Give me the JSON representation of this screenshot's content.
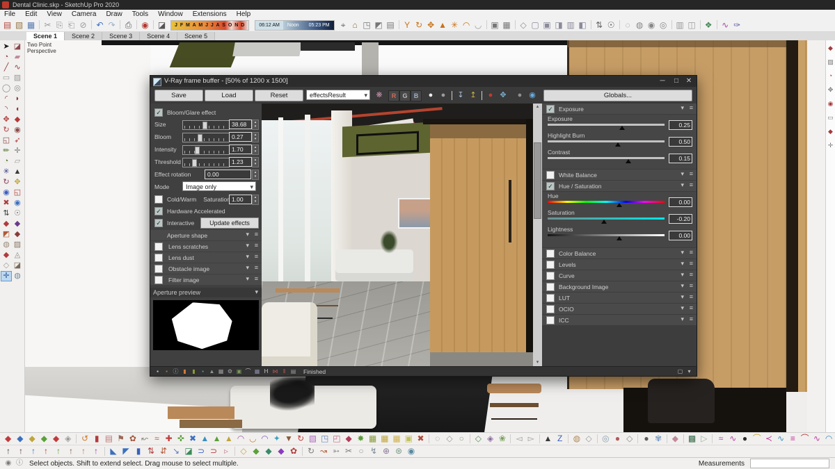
{
  "colors": {
    "accent_red": "#c0392b",
    "vray_panel": "#404040",
    "wood": "#c79d66",
    "select_blue": "#bcd8f0"
  },
  "window": {
    "title": "Dental Clinic.skp - SketchUp Pro 2020"
  },
  "menu": {
    "items": [
      "File",
      "Edit",
      "View",
      "Camera",
      "Draw",
      "Tools",
      "Window",
      "Extensions",
      "Help"
    ]
  },
  "toolbar": {
    "months": "J F M A M J J A S O N D",
    "time_start": "06:12 AM",
    "time_mid": "Noon",
    "time_end": "05:23 PM",
    "icons_a": [
      [
        "new-model",
        "▤",
        "#b34a3a"
      ],
      [
        "open-model",
        "▧",
        "#9a7a4a"
      ],
      [
        "save-model",
        "▦",
        "#5a7ab0"
      ],
      [
        "|"
      ],
      [
        "cut",
        "✂",
        "#9a9a9a"
      ],
      [
        "copy",
        "⎘",
        "#9a9a9a"
      ],
      [
        "paste",
        "⎗",
        "#9a9a9a"
      ],
      [
        "erase",
        "⊘",
        "#9a9a9a"
      ],
      [
        "|"
      ],
      [
        "undo",
        "↶",
        "#3a6fc4"
      ],
      [
        "redo",
        "↷",
        "#9ab0c8"
      ],
      [
        "|"
      ],
      [
        "print",
        "⎙",
        "#555555"
      ],
      [
        "|"
      ],
      [
        "vray-asset-editor",
        "◉",
        "#b3382e"
      ],
      [
        "|"
      ],
      [
        "shadow-eraser",
        "◪",
        "#555555"
      ]
    ],
    "icons_b": [
      [
        "in-model",
        "⌖",
        "#666666"
      ],
      [
        "components",
        "⌂",
        "#8a6d3b"
      ],
      [
        "materials",
        "◳",
        "#777777"
      ],
      [
        "styles",
        "◩",
        "#777777"
      ],
      [
        "export",
        "▤",
        "#777777"
      ],
      [
        "|"
      ],
      [
        "field-of-view",
        "Y",
        "#c8731a"
      ],
      [
        "orbit",
        "↻",
        "#c8731a"
      ],
      [
        "pan",
        "✥",
        "#c8731a"
      ],
      [
        "zoom",
        "▲",
        "#c8731a"
      ],
      [
        "zoom-extents",
        "✳",
        "#c8731a"
      ],
      [
        "previous-view",
        "◠",
        "#c8731a"
      ],
      [
        "next-view",
        "◡",
        "#999999"
      ],
      [
        "|"
      ],
      [
        "make-group",
        "▣",
        "#777777"
      ],
      [
        "make-component",
        "▦",
        "#777777"
      ],
      [
        "|"
      ],
      [
        "view-iso",
        "◇",
        "#8a8a9a"
      ],
      [
        "view-top",
        "▢",
        "#8a8a9a"
      ],
      [
        "view-front",
        "▣",
        "#8a8a9a"
      ],
      [
        "view-right",
        "◨",
        "#8a8a9a"
      ],
      [
        "view-back",
        "▥",
        "#8a8a9a"
      ],
      [
        "view-left",
        "◧",
        "#8a8a9a"
      ],
      [
        "|"
      ],
      [
        "walk-through",
        "⇅",
        "#666666"
      ],
      [
        "look-around",
        "☉",
        "#666666"
      ],
      [
        "|"
      ],
      [
        "style-wireframe",
        "◌",
        "#888888"
      ],
      [
        "style-shaded",
        "◍",
        "#888888"
      ],
      [
        "style-textured",
        "◉",
        "#888888"
      ],
      [
        "style-monochrome",
        "◎",
        "#888888"
      ],
      [
        "|"
      ],
      [
        "section-plane",
        "▥",
        "#999999"
      ],
      [
        "section-display",
        "◫",
        "#999999"
      ],
      [
        "|"
      ],
      [
        "tags",
        "❖",
        "#4a8a5a"
      ],
      [
        "|"
      ],
      [
        "bezier",
        "∿",
        "#a34a9a"
      ],
      [
        "3d-text",
        "✑",
        "#5a5aa3"
      ]
    ]
  },
  "scene_tabs": [
    "Scene 1",
    "Scene 2",
    "Scene 3",
    "Scene 4",
    "Scene 5"
  ],
  "palette_icons": [
    [
      "select",
      "➤",
      "#1a1a1a"
    ],
    [
      "eraser",
      "◪",
      "#8a4a4a"
    ],
    [
      "paint",
      "◔",
      "#8a4a4a"
    ],
    [
      "bucket",
      "▰",
      "#c08a9a"
    ],
    [
      "line",
      "╱",
      "#8a3b3b"
    ],
    [
      "freehand",
      "∿",
      "#8a3b3b"
    ],
    [
      "rectangle",
      "▭",
      "#9a9a9a"
    ],
    [
      "rotated-rectangle",
      "▨",
      "#9a9a9a"
    ],
    [
      "circle",
      "◯",
      "#8a8a8a"
    ],
    [
      "polygon",
      "◎",
      "#8a8a8a"
    ],
    [
      "arc",
      "◜",
      "#8a3b3b"
    ],
    [
      "pie",
      "◗",
      "#8a3b3b"
    ],
    [
      "arc-2",
      "◝",
      "#8a3b3b"
    ],
    [
      "pie-2",
      "◖",
      "#8a3b3b"
    ],
    [
      "move",
      "✥",
      "#b03b3b"
    ],
    [
      "push-pull",
      "◆",
      "#b03b3b"
    ],
    [
      "rotate",
      "↻",
      "#b03b3b"
    ],
    [
      "follow-me",
      "◉",
      "#8a4a4a"
    ],
    [
      "scale",
      "◱",
      "#8a4a4a"
    ],
    [
      "offset",
      "➶",
      "#b03b3b"
    ],
    [
      "tape-measure",
      "✏",
      "#5a7a3a"
    ],
    [
      "dimensions",
      "✛",
      "#7a7a7a"
    ],
    [
      "protractor",
      "◔",
      "#5a7a3a"
    ],
    [
      "text",
      "▱",
      "#9a9a9a"
    ],
    [
      "axes",
      "✳",
      "#3a3a8a"
    ],
    [
      "3d-text",
      "▲",
      "#3a3a3a"
    ],
    [
      "orbit",
      "↻",
      "#8a3b5a"
    ],
    [
      "pan",
      "✥",
      "#c0a53b"
    ],
    [
      "zoom",
      "◉",
      "#3b5fc0"
    ],
    [
      "zoom-window",
      "◱",
      "#b03b3b"
    ],
    [
      "zoom-extents",
      "✖",
      "#b03b3b"
    ],
    [
      "previous",
      "◉",
      "#3b6fc0"
    ],
    [
      "walk",
      "⇅",
      "#3a3a3a"
    ],
    [
      "look-around",
      "☉",
      "#7a7a7a"
    ],
    [
      "section",
      "◆",
      "#b03b3b"
    ],
    [
      "soften",
      "◆",
      "#6a3a8a"
    ],
    [
      "sandbox-from-contours",
      "◩",
      "#b05a3a"
    ],
    [
      "sandbox-from-scratch",
      "◆",
      "#8a3b3b"
    ],
    [
      "smoove",
      "◍",
      "#9a8a7a"
    ],
    [
      "stamp",
      "▨",
      "#8a7a6a"
    ],
    [
      "drape",
      "◆",
      "#b03b3b"
    ],
    [
      "add-detail",
      "◬",
      "#8a8a8a"
    ],
    [
      "flip-edge",
      "◇",
      "#9a9a9a"
    ],
    [
      "tool-extra",
      "◪",
      "#7a6a5a"
    ],
    [
      "active-tool",
      "✛",
      "#2a5a9a",
      "hl"
    ],
    [
      "tool-extra-2",
      "◍",
      "#7a8a9a"
    ]
  ],
  "rightstrip_icons": [
    [
      "solid-union",
      "◆",
      "#a33b3b"
    ],
    [
      "solid-subtract",
      "▨",
      "#777777"
    ],
    [
      "solid-trim",
      "◔",
      "#a33b3b"
    ],
    [
      "solid-intersect",
      "✥",
      "#777777"
    ],
    [
      "solid-split",
      "◉",
      "#a33b3b"
    ],
    [
      "outer-shell",
      "▭",
      "#777777"
    ],
    [
      "solid-tool",
      "◆",
      "#a33b3b"
    ],
    [
      "solid-tool-2",
      "✛",
      "#777777"
    ]
  ],
  "viewport": {
    "camera_label_line1": "Two Point",
    "camera_label_line2": "Perspective"
  },
  "vfb": {
    "title": "V-Ray frame buffer - [50% of 1200 x 1500]",
    "controls": {
      "minimize": "─",
      "maximize": "□",
      "close": "✕"
    },
    "buttons": {
      "save": "Save",
      "load": "Load",
      "reset": "Reset"
    },
    "channel_dropdown": "effectsResult",
    "rgb": [
      "R",
      "G",
      "B"
    ],
    "globals_button": "Globals...",
    "toolbar_icons_pre": [
      [
        "color-corrections",
        "❋",
        "#cc8fae"
      ]
    ],
    "toolbar_icons_mid": [
      [
        "show-rgb",
        "●",
        "#ececec"
      ],
      [
        "show-alpha",
        "●",
        "#9c9c9c"
      ],
      [
        "|"
      ],
      [
        "save-image",
        "↧",
        "#a8c0dc"
      ],
      [
        "load-image",
        "↥",
        "#d6b94a"
      ],
      [
        "|"
      ],
      [
        "clear-image",
        "●",
        "#c03b2e"
      ],
      [
        "follow-mouse",
        "✥",
        "#7ab0d0"
      ]
    ],
    "toolbar_icons_right": [
      [
        "render-sphere",
        "●",
        "#8f8f8f"
      ],
      [
        "lens-effects-eye",
        "◉",
        "#66aadd"
      ]
    ],
    "left": {
      "bloom_glare": {
        "label": "Bloom/Glare effect",
        "checked": true
      },
      "sliders": [
        {
          "label": "Size",
          "value": "38.68",
          "pos": 43
        },
        {
          "label": "Bloom",
          "value": "0.27",
          "pos": 32
        },
        {
          "label": "Intensity",
          "value": "1.70",
          "pos": 26
        },
        {
          "label": "Threshold",
          "value": "1.23",
          "pos": 20
        }
      ],
      "effect_rotation": {
        "label": "Effect rotation",
        "value": "0.00"
      },
      "mode": {
        "label": "Mode",
        "value": "Image only"
      },
      "cold_warm": {
        "label": "Cold/Warm",
        "checked": false,
        "sat_label": "Saturation",
        "sat_value": "1.00"
      },
      "hardware": {
        "label": "Hardware Accelerated",
        "checked": true
      },
      "interactive": {
        "label": "Interactive",
        "checked": true,
        "button": "Update effects"
      },
      "fx_rows": [
        {
          "label": "Aperture shape",
          "has_cb": false,
          "checked": false
        },
        {
          "label": "Lens scratches",
          "has_cb": true,
          "checked": false
        },
        {
          "label": "Lens dust",
          "has_cb": true,
          "checked": false
        },
        {
          "label": "Obstacle image",
          "has_cb": true,
          "checked": false
        },
        {
          "label": "Filter image",
          "has_cb": true,
          "checked": false
        }
      ],
      "aperture_preview_label": "Aperture preview"
    },
    "right": {
      "exposure": {
        "label": "Exposure",
        "checked": true,
        "rows": [
          {
            "label": "Exposure",
            "value": "0.25",
            "pos": 52
          },
          {
            "label": "Highlight Burn",
            "value": "0.50",
            "pos": 49
          },
          {
            "label": "Contrast",
            "value": "0.15",
            "pos": 56
          }
        ]
      },
      "white_balance": {
        "label": "White Balance",
        "checked": false
      },
      "huesat": {
        "label": "Hue / Saturation",
        "checked": true,
        "rows": [
          {
            "label": "Hue",
            "value": "0.00",
            "pos": 50
          },
          {
            "label": "Saturation",
            "value": "-0.20",
            "pos": 40
          },
          {
            "label": "Lightness",
            "value": "0.00",
            "pos": 50
          }
        ]
      },
      "collapsed": [
        {
          "label": "Color Balance"
        },
        {
          "label": "Levels"
        },
        {
          "label": "Curve"
        },
        {
          "label": "Background Image"
        },
        {
          "label": "LUT"
        },
        {
          "label": "OCIO"
        },
        {
          "label": "ICC"
        }
      ]
    },
    "footer_icons": [
      [
        "swatch",
        "▪",
        "#cccccc"
      ],
      [
        "mono",
        "▪",
        "#b06a4a"
      ],
      [
        "info",
        "ⓘ",
        "#9ab0b5"
      ],
      [
        "orange-bar",
        "▮",
        "#d07a3a"
      ],
      [
        "olive-bar",
        "▮",
        "#8a9a3a"
      ],
      [
        "teal",
        "▪",
        "#4a9a8a"
      ],
      [
        "mountain",
        "▲",
        "#8a9a8a"
      ],
      [
        "checker",
        "▦",
        "#9a9a9a"
      ],
      [
        "gear",
        "⚙",
        "#a5a5a5"
      ],
      [
        "image",
        "▣",
        "#7a9a5a"
      ],
      [
        "curve",
        "⌒",
        "#bbbbbb"
      ],
      [
        "grid",
        "▦",
        "#8a8aa5"
      ],
      [
        "histogram",
        "H",
        "#c5c5c5"
      ],
      [
        "split",
        "⋈",
        "#b05a5a"
      ],
      [
        "pause",
        "‖",
        "#c05a5a"
      ],
      [
        "note",
        "▤",
        "#9a9a9a"
      ]
    ],
    "footer_right_icons": [
      [
        "fit-window",
        "▢",
        "#bbbbbb"
      ],
      [
        "collapse",
        "▾",
        "#bbbbbb"
      ]
    ],
    "status": "Finished"
  },
  "btoolbar1_icons": [
    [
      "plugin",
      "◆",
      "#c03b3b"
    ],
    [
      "plugin",
      "◆",
      "#3b6fc0"
    ],
    [
      "plugin",
      "◆",
      "#c0a53b"
    ],
    [
      "plugin",
      "◆",
      "#5aa03b"
    ],
    [
      "plugin",
      "◆",
      "#c03b3b"
    ],
    [
      "plugin",
      "◈",
      "#9a9a9a"
    ],
    [
      "|"
    ],
    [
      "plugin",
      "↺",
      "#d07a2a"
    ],
    [
      "plugin",
      "▮",
      "#b33b3b"
    ],
    [
      "plugin",
      "▤",
      "#c07a7a"
    ],
    [
      "plugin",
      "⚑",
      "#9a6a5a"
    ],
    [
      "plugin",
      "✿",
      "#a3553a"
    ],
    [
      "plugin",
      "↜",
      "#8a8a8a"
    ],
    [
      "plugin",
      "≈",
      "#b05a3a"
    ],
    [
      "plugin",
      "✚",
      "#c03b3b"
    ],
    [
      "plugin",
      "✜",
      "#5aa03b"
    ],
    [
      "plugin",
      "✖",
      "#3b6fc0"
    ],
    [
      "plugin",
      "▲",
      "#3b8fc0"
    ],
    [
      "plugin",
      "▲",
      "#5aa03b"
    ],
    [
      "plugin",
      "▲",
      "#c0a53b"
    ],
    [
      "plugin",
      "◠",
      "#a35aa3"
    ],
    [
      "plugin",
      "◡",
      "#c07a3a"
    ],
    [
      "plugin",
      "◠",
      "#8a5ac0"
    ],
    [
      "plugin",
      "✦",
      "#3ba3c0"
    ],
    [
      "plugin",
      "▼",
      "#8a5a3a"
    ],
    [
      "plugin",
      "↻",
      "#c03b3b"
    ],
    [
      "plugin",
      "▧",
      "#b06ac0"
    ],
    [
      "plugin",
      "◳",
      "#6a8ac0"
    ],
    [
      "plugin",
      "◰",
      "#c06a8a"
    ],
    [
      "plugin",
      "◆",
      "#b03b5a"
    ],
    [
      "plugin",
      "✸",
      "#5a9a3b"
    ],
    [
      "plugin",
      "▦",
      "#8a9a3a"
    ],
    [
      "plugin",
      "▦",
      "#c0a53b"
    ],
    [
      "plugin",
      "▦",
      "#d0b04a"
    ],
    [
      "plugin",
      "▣",
      "#c0c05a"
    ],
    [
      "plugin",
      "✖",
      "#b04a3a"
    ],
    [
      "|"
    ],
    [
      "plugin",
      "◌",
      "#8a8a8a"
    ],
    [
      "plugin",
      "◇",
      "#9a9a9a"
    ],
    [
      "plugin",
      "○",
      "#8aa08a"
    ],
    [
      "|"
    ],
    [
      "plugin",
      "◇",
      "#5a8a5a"
    ],
    [
      "plugin",
      "◈",
      "#8a6aa0"
    ],
    [
      "plugin",
      "❀",
      "#7aa05a"
    ],
    [
      "|"
    ],
    [
      "plugin",
      "◅",
      "#9a9a9a"
    ],
    [
      "plugin",
      "▻",
      "#9a9a9a"
    ],
    [
      "|"
    ],
    [
      "plugin",
      "▲",
      "#3a3a3a"
    ],
    [
      "plugin",
      "Z",
      "#3b5fc0"
    ],
    [
      "|"
    ],
    [
      "plugin",
      "◍",
      "#b08a5a"
    ],
    [
      "plugin",
      "◇",
      "#9a9a9a"
    ],
    [
      "|"
    ],
    [
      "plugin",
      "◎",
      "#8aa0b0"
    ],
    [
      "plugin",
      "●",
      "#b05a5a"
    ],
    [
      "plugin",
      "◇",
      "#8a8a8a"
    ],
    [
      "|"
    ],
    [
      "plugin",
      "●",
      "#5a5a5a"
    ],
    [
      "plugin",
      "✾",
      "#7a9ac0"
    ],
    [
      "|"
    ],
    [
      "plugin",
      "◆",
      "#c08a9a"
    ],
    [
      "|"
    ],
    [
      "plugin",
      "▩",
      "#3a6a4a"
    ],
    [
      "plugin",
      "▷",
      "#9ab0a0"
    ],
    [
      "|"
    ],
    [
      "plugin",
      "≈",
      "#c03ba3"
    ],
    [
      "plugin",
      "∿",
      "#c03ba3"
    ],
    [
      "plugin",
      "●",
      "#2a2a2a"
    ],
    [
      "plugin",
      "⌒",
      "#d0a53b"
    ],
    [
      "plugin",
      "≺",
      "#c03ba3"
    ],
    [
      "plugin",
      "∿",
      "#3b8fc0"
    ],
    [
      "plugin",
      "≡",
      "#c03ba3"
    ],
    [
      "plugin",
      "⌒",
      "#b33b3b"
    ],
    [
      "plugin",
      "∿",
      "#c03ba3"
    ],
    [
      "plugin",
      "◠",
      "#3b8fc0"
    ]
  ],
  "btoolbar2_icons": [
    [
      "plugin",
      "↑",
      "#3a3a3a"
    ],
    [
      "plugin",
      "↑",
      "#5a3a3a"
    ],
    [
      "plugin",
      "↑",
      "#3b6fc0"
    ],
    [
      "plugin",
      "↑",
      "#b33b3b"
    ],
    [
      "plugin",
      "↑",
      "#5aa03b"
    ],
    [
      "plugin",
      "↑",
      "#7a5a3a"
    ],
    [
      "plugin",
      "↑",
      "#c07a3a"
    ],
    [
      "plugin",
      "↑",
      "#a33ba3"
    ],
    [
      "|"
    ],
    [
      "plugin",
      "◣",
      "#3b6fc0"
    ],
    [
      "plugin",
      "◤",
      "#3b6fc0"
    ],
    [
      "plugin",
      "▮",
      "#3b5fc0"
    ],
    [
      "plugin",
      "⇅",
      "#b33b3b"
    ],
    [
      "plugin",
      "⇵",
      "#b35a3b"
    ],
    [
      "plugin",
      "↘",
      "#5a7ac0"
    ],
    [
      "plugin",
      "◪",
      "#3a8a5a"
    ],
    [
      "plugin",
      "⊃",
      "#3b5fc0"
    ],
    [
      "plugin",
      "⊃",
      "#b33b3b"
    ],
    [
      "plugin",
      "▹",
      "#c08aa0"
    ],
    [
      "|"
    ],
    [
      "plugin",
      "◇",
      "#c0a53b"
    ],
    [
      "plugin",
      "◆",
      "#5aa03b"
    ],
    [
      "plugin",
      "◆",
      "#3a8a6a"
    ],
    [
      "plugin",
      "◆",
      "#8a3ac0"
    ],
    [
      "plugin",
      "✿",
      "#b33b3b"
    ],
    [
      "|"
    ],
    [
      "plugin",
      "↻",
      "#7a7a7a"
    ],
    [
      "plugin",
      "↝",
      "#b05a3a"
    ],
    [
      "plugin",
      "➳",
      "#8a8a8a"
    ],
    [
      "plugin",
      "✂",
      "#7a7a7a"
    ],
    [
      "plugin",
      "○",
      "#9a9a9a"
    ],
    [
      "plugin",
      "↯",
      "#7a8a9a"
    ],
    [
      "plugin",
      "⊕",
      "#8a7a9a"
    ],
    [
      "plugin",
      "⊛",
      "#7a9a8a"
    ],
    [
      "plugin",
      "◉",
      "#5a8aa0"
    ]
  ],
  "statusbar": {
    "icons": [
      [
        "geolocation",
        "◉",
        "#7a7a7a"
      ],
      [
        "credits",
        "ⓘ",
        "#7a7a7a"
      ]
    ],
    "hint": "Select objects. Shift to extend select. Drag mouse to select multiple.",
    "measurements_label": "Measurements"
  }
}
